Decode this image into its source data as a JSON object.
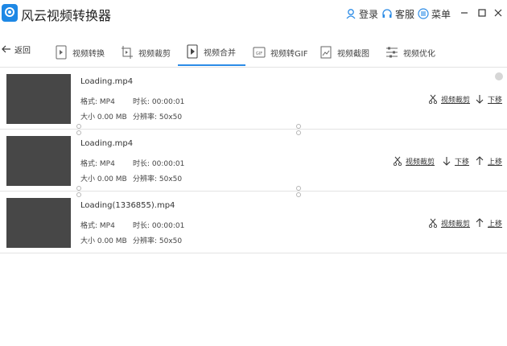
{
  "window": {
    "title": "风云视频转换器",
    "login_label": "登录",
    "service_label": "客服",
    "menu_label": "菜单"
  },
  "toolbar": {
    "back_label": "返回",
    "tabs": [
      {
        "label": "视频转换",
        "icon": "video-convert-icon",
        "active": false
      },
      {
        "label": "视频裁剪",
        "icon": "video-crop-icon",
        "active": false
      },
      {
        "label": "视频合并",
        "icon": "video-merge-icon",
        "active": true
      },
      {
        "label": "视频转GIF",
        "icon": "gif-icon",
        "active": false
      },
      {
        "label": "视频截图",
        "icon": "screenshot-icon",
        "active": false
      },
      {
        "label": "视频优化",
        "icon": "optimize-icon",
        "active": false
      }
    ]
  },
  "files": [
    {
      "name": "Loading.mp4",
      "format": "格式: MP4",
      "duration": "时长: 00:00:01",
      "size": "大小 0.00 MB",
      "resolution": "分辨率: 50x50",
      "crop_label": "视频裁剪",
      "down_label": "下移"
    },
    {
      "name": "Loading.mp4",
      "format": "格式: MP4",
      "duration": "时长: 00:00:01",
      "size": "大小 0.00 MB",
      "resolution": "分辨率: 50x50",
      "crop_label": "视频裁剪",
      "down_label": "下移",
      "up_label": "上移"
    },
    {
      "name": "Loading(1336855).mp4",
      "format": "格式: MP4",
      "duration": "时长: 00:00:01",
      "size": "大小 0.00 MB",
      "resolution": "分辨率: 50x50",
      "crop_label": "视频裁剪",
      "up_label": "上移"
    }
  ],
  "colors": {
    "accent": "#2b8be6",
    "thumbnail": "#474747",
    "logo": "#1e88e5"
  }
}
